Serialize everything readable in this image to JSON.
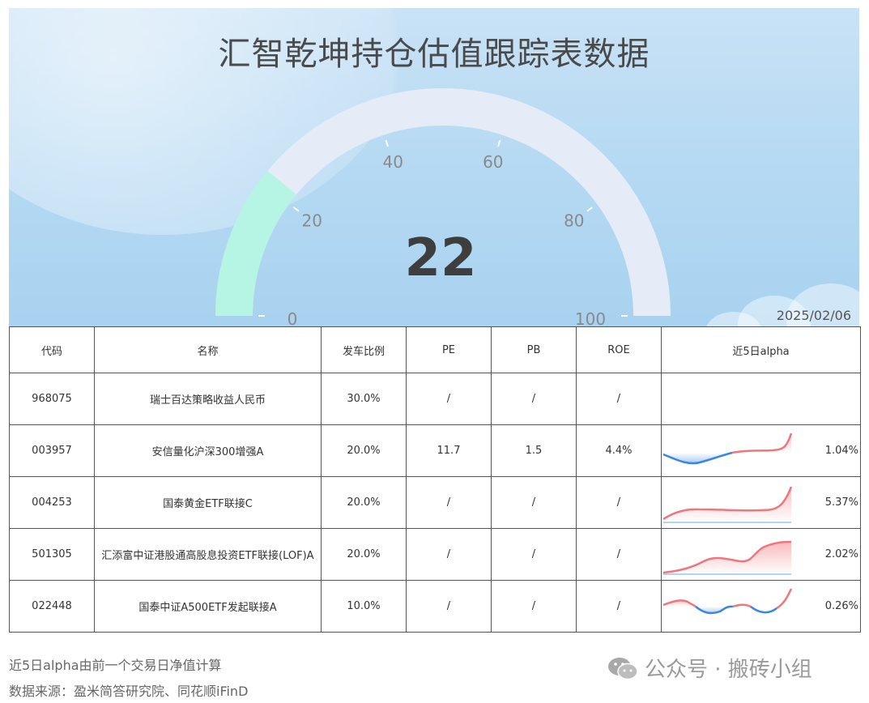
{
  "title": "汇智乾坤持仓估值跟踪表数据",
  "gauge": {
    "value": "22",
    "level": 22,
    "min": 0,
    "max": 100,
    "ticks": [
      "0",
      "20",
      "40",
      "60",
      "80",
      "100"
    ]
  },
  "date": "2025/02/06",
  "colors": {
    "gauge_fill": "#b6f4e4",
    "gauge_track": "#e6ecf7",
    "up": "#f0767b",
    "down": "#3a86e6"
  },
  "table": {
    "headers": [
      "代码",
      "名称",
      "发车比例",
      "PE",
      "PB",
      "ROE",
      "近5日alpha"
    ],
    "rows": [
      {
        "code": "968075",
        "name": "瑞士百达策略收益人民币",
        "ratio": "30.0%",
        "pe": "/",
        "pb": "/",
        "roe": "/",
        "alpha": ""
      },
      {
        "code": "003957",
        "name": "安信量化沪深300增强A",
        "ratio": "20.0%",
        "pe": "11.7",
        "pb": "1.5",
        "roe": "4.4%",
        "alpha": "1.04%"
      },
      {
        "code": "004253",
        "name": "国泰黄金ETF联接C",
        "ratio": "20.0%",
        "pe": "/",
        "pb": "/",
        "roe": "/",
        "alpha": "5.37%"
      },
      {
        "code": "501305",
        "name": "汇添富中证港股通高股息投资ETF联接(LOF)A",
        "ratio": "20.0%",
        "pe": "/",
        "pb": "/",
        "roe": "/",
        "alpha": "2.02%"
      },
      {
        "code": "022448",
        "name": "国泰中证A500ETF发起联接A",
        "ratio": "10.0%",
        "pe": "/",
        "pb": "/",
        "roe": "/",
        "alpha": "0.26%"
      }
    ]
  },
  "notes": [
    "近5日alpha由前一个交易日净值计算",
    "数据来源：盈米简答研究院、同花顺iFinD"
  ],
  "watermark": "公众号 · 搬砖小组"
}
